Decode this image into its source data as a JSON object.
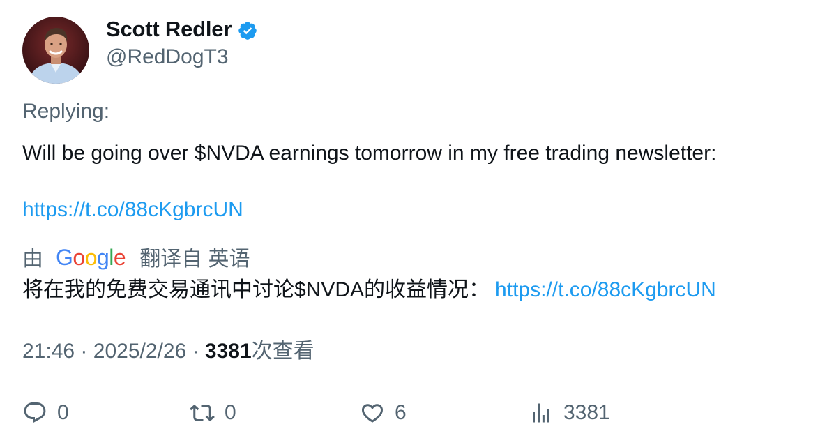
{
  "author": {
    "display_name": "Scott Redler",
    "handle": "@RedDogT3",
    "verified": true,
    "avatar": "avatar-photo"
  },
  "reply_context": {
    "label": "Replying:"
  },
  "tweet": {
    "text": "Will be going over $NVDA earnings tomorrow in my free trading newsletter:",
    "link": "https://t.co/88cKgbrcUN"
  },
  "translation": {
    "by_label": "由",
    "provider_logo_text": "Google",
    "from_label": "翻译自 英语",
    "text": "将在我的免费交易通讯中讨论$NVDA的收益情况：",
    "link": "https://t.co/88cKgbrcUN"
  },
  "meta": {
    "time": "21:46",
    "separator": "·",
    "date": "2025/2/26",
    "views_count": "3381",
    "views_label": "次查看"
  },
  "actions": {
    "reply_count": "0",
    "retweet_count": "0",
    "like_count": "6",
    "views_count": "3381"
  },
  "colors": {
    "link": "#1d9bf0",
    "secondary_text": "#536471",
    "primary_text": "#0f1419",
    "verified_badge": "#1d9bf0"
  }
}
